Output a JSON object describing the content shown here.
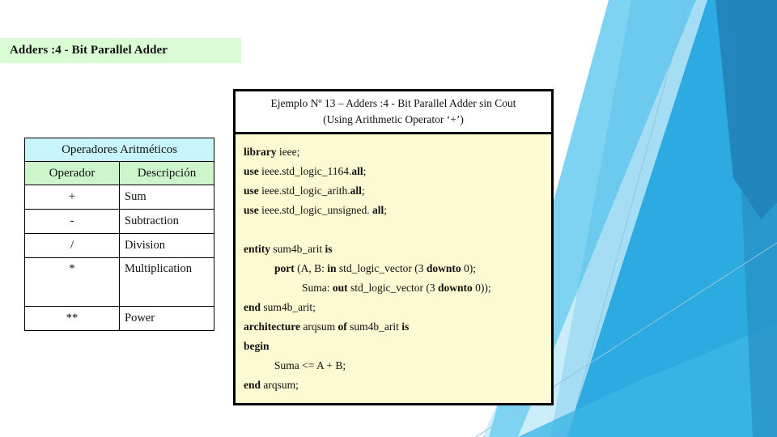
{
  "slide": {
    "title": "Adders :4 - Bit Parallel Adder",
    "title_bg": "#d9fcd4",
    "background": "#ffffff",
    "accent_blues": [
      "#7fd4f2",
      "#29abe2",
      "#1b7fb5",
      "#2d93c8",
      "#cfeefb",
      "#2a6f9e"
    ]
  },
  "operators_table": {
    "caption": "Operadores Aritméticos",
    "caption_bg": "#c8f5fb",
    "header_bg": "#ccf5cc",
    "columns": [
      "Operador",
      "Descripción"
    ],
    "rows": [
      {
        "operator": "+",
        "description": "Sum"
      },
      {
        "operator": "-",
        "description": "Subtraction"
      },
      {
        "operator": "/",
        "description": "Division"
      },
      {
        "operator": "*",
        "description": "Multiplication"
      },
      {
        "operator": "**",
        "description": "Power"
      }
    ]
  },
  "example_panel": {
    "header_line1": "Ejemplo Nº 13 – Adders :4 - Bit Parallel Adder sin Cout",
    "header_line2": "(Using Arithmetic Operator ‘+’)",
    "code_bg": "#fcfad2",
    "code_lines": [
      {
        "segments": [
          {
            "t": "library",
            "b": true
          },
          {
            "t": " ieee;",
            "b": false
          }
        ],
        "indent": 0
      },
      {
        "segments": [
          {
            "t": "use",
            "b": true
          },
          {
            "t": " ieee.std_logic_1164.",
            "b": false
          },
          {
            "t": "all",
            "b": true
          },
          {
            "t": ";",
            "b": false
          }
        ],
        "indent": 0
      },
      {
        "segments": [
          {
            "t": "use",
            "b": true
          },
          {
            "t": " ieee.std_logic_arith.",
            "b": false
          },
          {
            "t": "all",
            "b": true
          },
          {
            "t": ";",
            "b": false
          }
        ],
        "indent": 0
      },
      {
        "segments": [
          {
            "t": "use",
            "b": true
          },
          {
            "t": " ieee.std_logic_unsigned. ",
            "b": false
          },
          {
            "t": "all",
            "b": true
          },
          {
            "t": ";",
            "b": false
          }
        ],
        "indent": 0
      },
      {
        "segments": [],
        "indent": 0
      },
      {
        "segments": [
          {
            "t": "entity",
            "b": true
          },
          {
            "t": " sum4b_arit ",
            "b": false
          },
          {
            "t": "is",
            "b": true
          }
        ],
        "indent": 0
      },
      {
        "segments": [
          {
            "t": "port",
            "b": true
          },
          {
            "t": " (A, B: ",
            "b": false
          },
          {
            "t": "in",
            "b": true
          },
          {
            "t": " std_logic_vector (3 ",
            "b": false
          },
          {
            "t": "downto",
            "b": true
          },
          {
            "t": " 0);",
            "b": false
          }
        ],
        "indent": 1
      },
      {
        "segments": [
          {
            "t": "Suma: ",
            "b": false
          },
          {
            "t": "out",
            "b": true
          },
          {
            "t": " std_logic_vector (3 ",
            "b": false
          },
          {
            "t": "downto",
            "b": true
          },
          {
            "t": " 0));",
            "b": false
          }
        ],
        "indent": 2
      },
      {
        "segments": [
          {
            "t": "end",
            "b": true
          },
          {
            "t": " sum4b_arit;",
            "b": false
          }
        ],
        "indent": 0
      },
      {
        "segments": [
          {
            "t": "architecture",
            "b": true
          },
          {
            "t": " arqsum ",
            "b": false
          },
          {
            "t": "of",
            "b": true
          },
          {
            "t": " sum4b_arit ",
            "b": false
          },
          {
            "t": "is",
            "b": true
          }
        ],
        "indent": 0
      },
      {
        "segments": [
          {
            "t": "begin",
            "b": true
          }
        ],
        "indent": 0
      },
      {
        "segments": [
          {
            "t": "Suma <= A + B;",
            "b": false
          }
        ],
        "indent": 1
      },
      {
        "segments": [
          {
            "t": "end",
            "b": true
          },
          {
            "t": " arqsum;",
            "b": false
          }
        ],
        "indent": 0
      }
    ]
  }
}
